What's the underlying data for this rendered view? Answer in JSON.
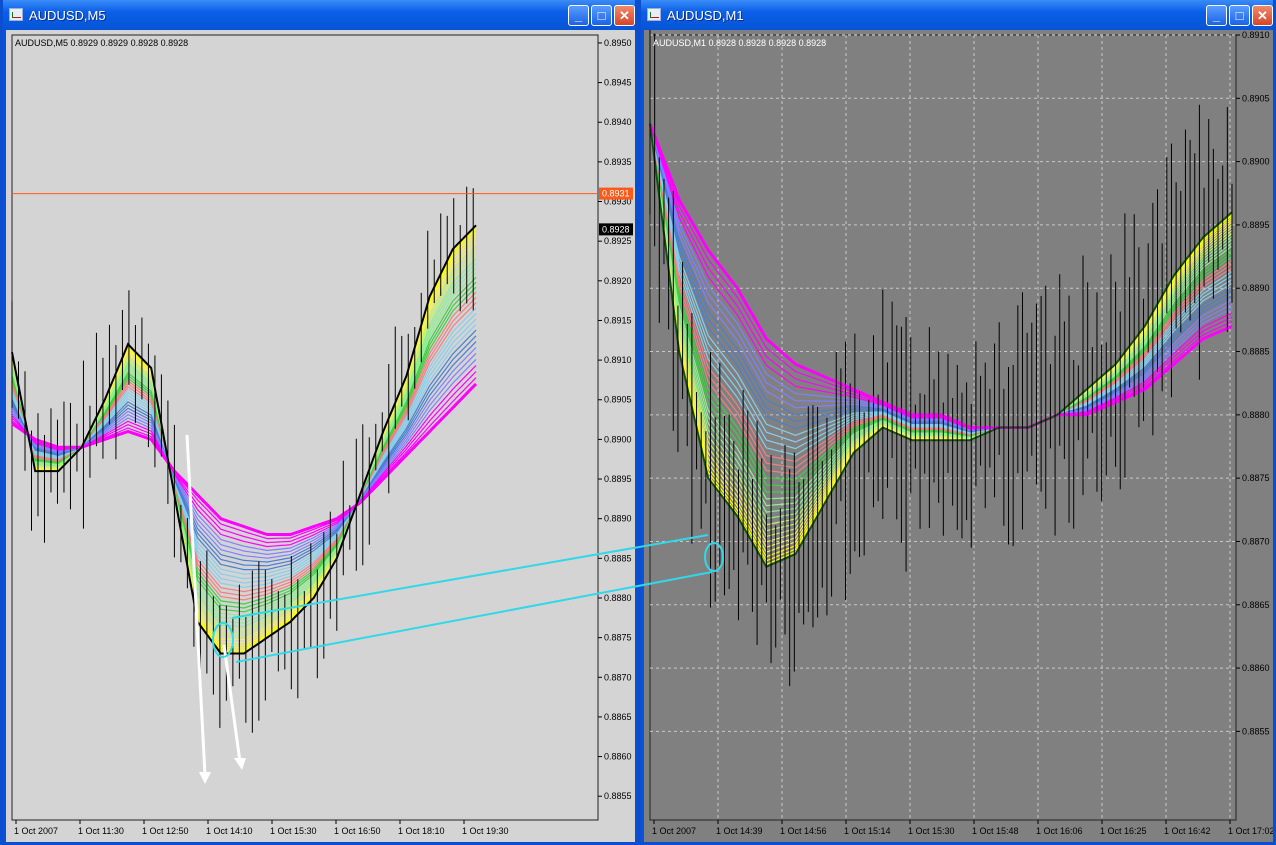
{
  "left_window": {
    "title": "AUDUSD,M5",
    "info_line": "AUDUSD,M5  0.8929 0.8929 0.8928 0.8928",
    "hline_label": "0.8931",
    "price_label": "0.8928",
    "buttons": {
      "minimize": "_",
      "maximize": "□",
      "close": "✕"
    }
  },
  "right_window": {
    "title": "AUDUSD,M1",
    "info_line": "AUDUSD,M1  0.8928 0.8928 0.8928 0.8928",
    "buttons": {
      "minimize": "_",
      "maximize": "□",
      "close": "✕"
    }
  },
  "colors": {
    "accent": "#0a53d9",
    "left_bg": "#d4d4d4",
    "right_bg": "#808080",
    "cyan_arrow": "#30d8e8",
    "hline": "#ff5a1a",
    "ribbon": [
      "#ffff00",
      "#f4f060",
      "#c8f070",
      "#90ee90",
      "#40d040",
      "#f08080",
      "#87ceeb",
      "#4a7fd0",
      "#8080ff",
      "#ff00ff"
    ]
  },
  "chart_data": [
    {
      "type": "line",
      "symbol": "AUDUSD",
      "timeframe": "M5",
      "ylim": [
        0.8852,
        0.8951
      ],
      "y_ticks": [
        "0.8950",
        "0.8945",
        "0.8940",
        "0.8935",
        "0.8930",
        "0.8925",
        "0.8920",
        "0.8915",
        "0.8910",
        "0.8905",
        "0.8900",
        "0.8895",
        "0.8890",
        "0.8885",
        "0.8880",
        "0.8875",
        "0.8870",
        "0.8865",
        "0.8860",
        "0.8855"
      ],
      "x_ticks": [
        "1 Oct 2007",
        "1 Oct 11:30",
        "1 Oct 12:50",
        "1 Oct 14:10",
        "1 Oct 15:30",
        "1 Oct 16:50",
        "1 Oct 18:10",
        "1 Oct 19:30"
      ],
      "horizontal_line": 0.8931,
      "last_price": 0.8928,
      "series": [
        {
          "x": [
            0,
            5,
            10,
            15,
            20,
            25,
            30,
            35,
            40,
            45,
            50,
            55,
            60,
            65,
            70,
            75,
            80,
            85,
            90,
            95,
            100
          ],
          "values": [
            0.8911,
            0.8896,
            0.8896,
            0.8899,
            0.8905,
            0.8912,
            0.8909,
            0.8893,
            0.8877,
            0.8873,
            0.8873,
            0.8875,
            0.8877,
            0.888,
            0.8885,
            0.8893,
            0.8901,
            0.8908,
            0.8918,
            0.8924,
            0.8927
          ]
        },
        {
          "x": [
            0,
            5,
            10,
            15,
            20,
            25,
            30,
            35,
            40,
            45,
            50,
            55,
            60,
            65,
            70,
            75,
            80,
            85,
            90,
            95,
            100
          ],
          "values": [
            0.8902,
            0.89,
            0.8899,
            0.8899,
            0.89,
            0.8901,
            0.89,
            0.8896,
            0.8893,
            0.889,
            0.8889,
            0.8888,
            0.8888,
            0.8889,
            0.889,
            0.8892,
            0.8895,
            0.8898,
            0.8901,
            0.8904,
            0.8907
          ]
        }
      ]
    },
    {
      "type": "line",
      "symbol": "AUDUSD",
      "timeframe": "M1",
      "ylim": [
        0.8848,
        0.891
      ],
      "y_ticks": [
        "0.8910",
        "0.8905",
        "0.8900",
        "0.8895",
        "0.8890",
        "0.8885",
        "0.8880",
        "0.8875",
        "0.8870",
        "0.8865",
        "0.8860",
        "0.8855"
      ],
      "x_ticks": [
        "1 Oct 2007",
        "1 Oct 14:39",
        "1 Oct 14:56",
        "1 Oct 15:14",
        "1 Oct 15:30",
        "1 Oct 15:48",
        "1 Oct 16:06",
        "1 Oct 16:25",
        "1 Oct 16:42",
        "1 Oct 17:02"
      ],
      "series": [
        {
          "x": [
            0,
            5,
            10,
            15,
            20,
            25,
            30,
            35,
            40,
            45,
            50,
            55,
            60,
            65,
            70,
            75,
            80,
            85,
            90,
            95,
            100
          ],
          "values": [
            0.8903,
            0.8885,
            0.8875,
            0.8872,
            0.8868,
            0.8869,
            0.8873,
            0.8877,
            0.8879,
            0.8878,
            0.8878,
            0.8878,
            0.8879,
            0.8879,
            0.888,
            0.8882,
            0.8884,
            0.8887,
            0.8891,
            0.8894,
            0.8896
          ]
        },
        {
          "x": [
            0,
            5,
            10,
            15,
            20,
            25,
            30,
            35,
            40,
            45,
            50,
            55,
            60,
            65,
            70,
            75,
            80,
            85,
            90,
            95,
            100
          ],
          "values": [
            0.8903,
            0.8897,
            0.8893,
            0.889,
            0.8886,
            0.8884,
            0.8883,
            0.8882,
            0.8881,
            0.888,
            0.888,
            0.8879,
            0.8879,
            0.8879,
            0.888,
            0.888,
            0.8881,
            0.8882,
            0.8884,
            0.8886,
            0.8887
          ]
        }
      ]
    }
  ]
}
